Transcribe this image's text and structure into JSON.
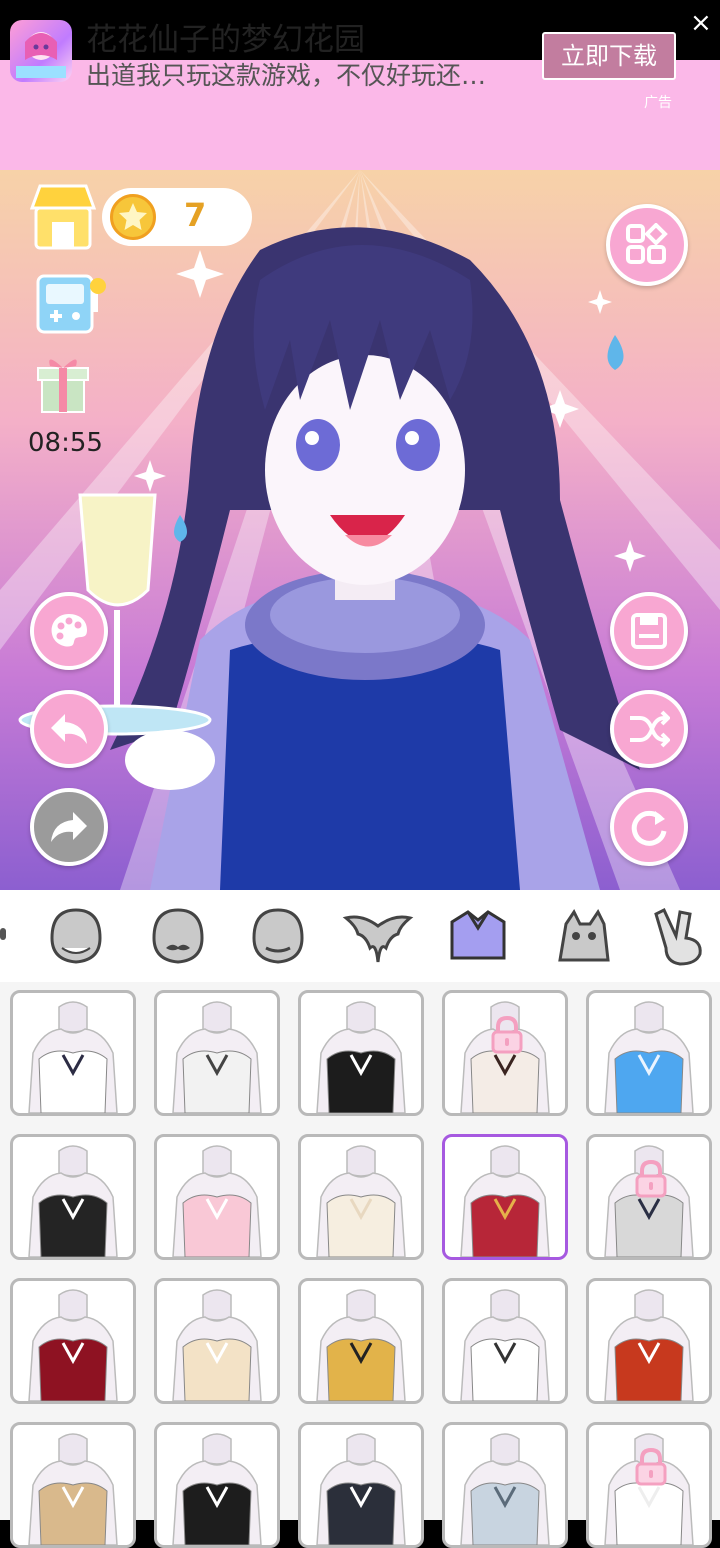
{
  "ad": {
    "title": "花花仙子的梦幻花园",
    "subtitle": "出道我只玩这款游戏，不仅好玩还…",
    "button_label": "立即下载",
    "close_label": "×",
    "ad_tag": "广告"
  },
  "hud": {
    "coins": "7",
    "timer": "08:55"
  },
  "tabs": [
    {
      "icon": "face-blank-icon"
    },
    {
      "icon": "face-mustache-icon"
    },
    {
      "icon": "face-bald-icon"
    },
    {
      "icon": "wings-icon"
    },
    {
      "icon": "shirt-icon",
      "selected": true
    },
    {
      "icon": "pet-icon"
    },
    {
      "icon": "peace-hand-icon"
    }
  ],
  "colors": {
    "accent_pink": "#f8a7d2",
    "ad_background": "#fbb8e8",
    "selected_border": "#a659e0",
    "coin_text": "#e5a124"
  },
  "outfits": [
    {
      "name": "white-jacket-paw",
      "locked": false
    },
    {
      "name": "white-strap-top",
      "locked": false
    },
    {
      "name": "black-cat-tee",
      "locked": false
    },
    {
      "name": "black-vest-kimono",
      "locked": true
    },
    {
      "name": "blue-offshoulder",
      "locked": false
    },
    {
      "name": "black-button-top",
      "locked": false
    },
    {
      "name": "pink-vneck",
      "locked": false
    },
    {
      "name": "cream-drape",
      "locked": false
    },
    {
      "name": "red-tank",
      "locked": false,
      "selected": true
    },
    {
      "name": "grey-cutout",
      "locked": true
    },
    {
      "name": "red-scarf",
      "locked": false
    },
    {
      "name": "fur-top",
      "locked": false
    },
    {
      "name": "gold-collar",
      "locked": false
    },
    {
      "name": "pendant-necklace",
      "locked": false
    },
    {
      "name": "red-halter",
      "locked": false
    },
    {
      "name": "tan-vest",
      "locked": false
    },
    {
      "name": "black-tux",
      "locked": false
    },
    {
      "name": "black-vneck",
      "locked": false
    },
    {
      "name": "grey-hoodie",
      "locked": false
    },
    {
      "name": "white-locked",
      "locked": true
    }
  ]
}
